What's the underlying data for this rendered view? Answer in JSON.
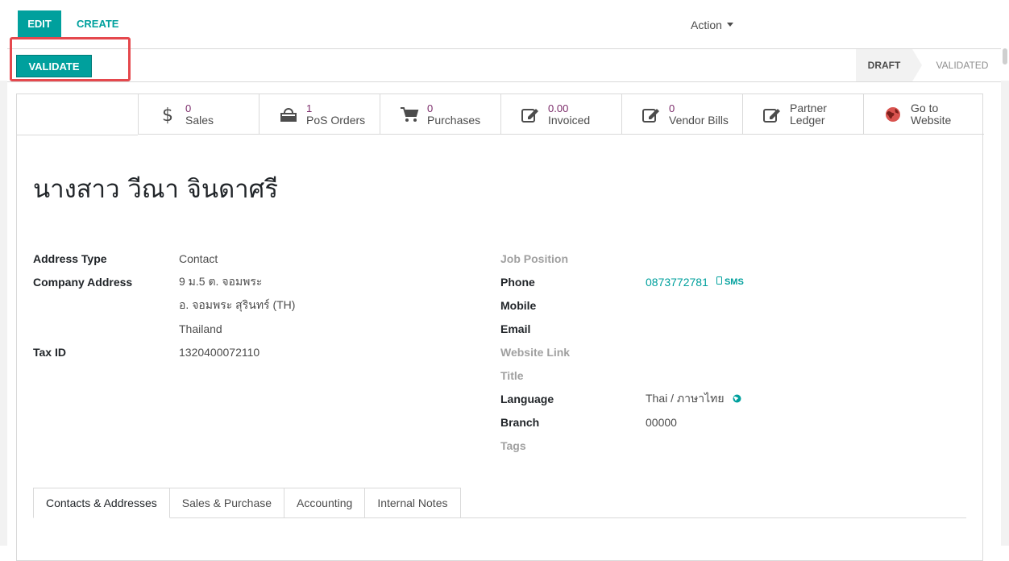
{
  "toolbar": {
    "edit_label": "EDIT",
    "create_label": "CREATE",
    "action_label": "Action"
  },
  "statusbar": {
    "validate_label": "VALIDATE",
    "stages": [
      "DRAFT",
      "VALIDATED"
    ],
    "current_stage": "DRAFT"
  },
  "smart_buttons": [
    {
      "icon": "dollar-icon",
      "value": "0",
      "label": "Sales"
    },
    {
      "icon": "shopping-bag-icon",
      "value": "1",
      "label": "PoS Orders"
    },
    {
      "icon": "cart-icon",
      "value": "0",
      "label": "Purchases"
    },
    {
      "icon": "pencil-square-icon",
      "value": "0.00",
      "label": "Invoiced"
    },
    {
      "icon": "pencil-square-icon",
      "value": "0",
      "label": "Vendor Bills"
    },
    {
      "icon": "pencil-square-icon",
      "value": "Partner",
      "label": "Ledger"
    },
    {
      "icon": "globe-icon",
      "value": "Go to",
      "label": "Website"
    }
  ],
  "partner": {
    "name": "นางสาว วีณา จินดาศรี",
    "left_fields": {
      "address_type_label": "Address Type",
      "address_type": "Contact",
      "company_address_label": "Company Address",
      "address_line1": "9 ม.5 ต. จอมพระ",
      "address_line2": "อ. จอมพระ สุรินทร์ (TH)",
      "address_country": "Thailand",
      "tax_id_label": "Tax ID",
      "tax_id": "1320400072110"
    },
    "right_fields": {
      "job_position_label": "Job Position",
      "phone_label": "Phone",
      "phone": "0873772781",
      "sms_label": "SMS",
      "mobile_label": "Mobile",
      "email_label": "Email",
      "website_label": "Website Link",
      "title_label": "Title",
      "language_label": "Language",
      "language": "Thai / ภาษาไทย",
      "branch_label": "Branch",
      "branch": "00000",
      "tags_label": "Tags"
    }
  },
  "tabs": [
    "Contacts & Addresses",
    "Sales & Purchase",
    "Accounting",
    "Internal Notes"
  ],
  "colors": {
    "primary": "#00a09d",
    "accent": "#7c2c6b",
    "highlight": "#e5484d"
  }
}
